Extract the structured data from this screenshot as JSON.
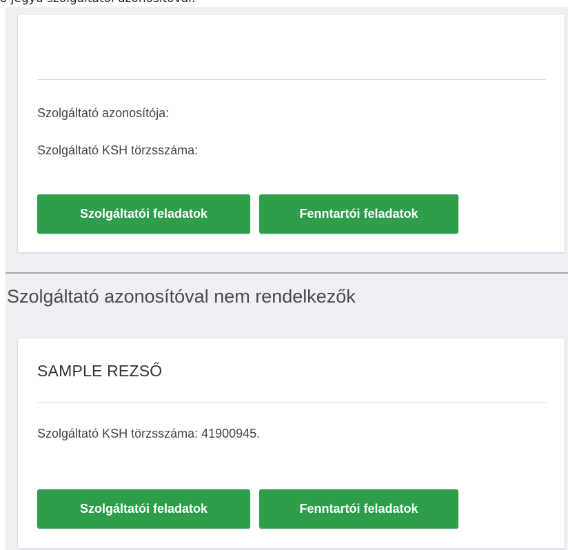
{
  "top_text": "ó jegyű szolgáltatói azonosítóval:",
  "card1": {
    "title": "",
    "provider_id_label": "Szolgáltató azonosítója:",
    "ksh_label": "Szolgáltató KSH törzsszáma:",
    "button_provider": "Szolgáltatói feladatok",
    "button_maintainer": "Fenntartói feladatok"
  },
  "section": {
    "heading": "Szolgáltató azonosítóval nem rendelkezők"
  },
  "card2": {
    "title": "SAMPLE REZSŐ",
    "ksh_text": "Szolgáltató KSH törzsszáma: 41900945.",
    "button_provider": "Szolgáltatói feladatok",
    "button_maintainer": "Fenntartói feladatok"
  },
  "colors": {
    "button_green": "#2e9e4b",
    "panel_bg": "#eef0f5",
    "card_bg": "#ffffff"
  }
}
